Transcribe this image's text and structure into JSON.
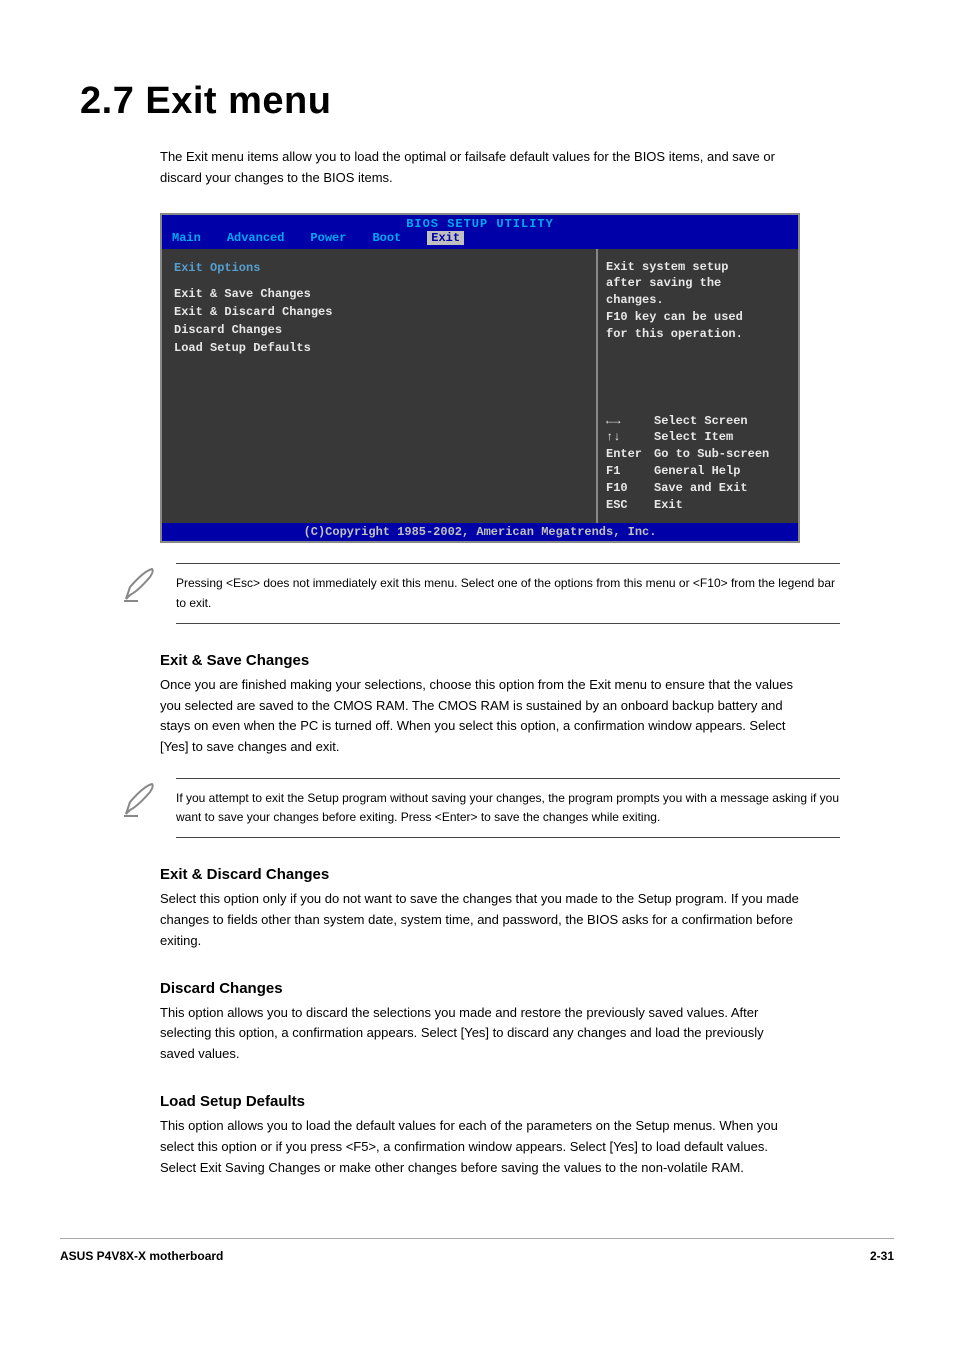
{
  "heading": "2.7    Exit menu",
  "intro": "The Exit menu items allow you to load the optimal or failsafe default values for the BIOS items, and save or discard your changes to the BIOS items.",
  "bios": {
    "title": "BIOS SETUP UTILITY",
    "tabs": [
      "Main",
      "Advanced",
      "Power",
      "Boot",
      "Exit"
    ],
    "active_tab": "Exit",
    "left_heading": "Exit Options",
    "items": [
      "Exit & Save Changes",
      "Exit & Discard Changes",
      "Discard Changes",
      "",
      "Load Setup Defaults"
    ],
    "right_help": [
      "Exit system setup",
      "after saving the",
      "changes.",
      "",
      "F10 key can be used",
      "for this operation."
    ],
    "legend": [
      {
        "key": "←→",
        "label": "Select Screen"
      },
      {
        "key": "↑↓",
        "label": "Select Item"
      },
      {
        "key": "Enter",
        "label": "Go to Sub-screen"
      },
      {
        "key": "F1",
        "label": "General Help"
      },
      {
        "key": "F10",
        "label": "Save and Exit"
      },
      {
        "key": "ESC",
        "label": "Exit"
      }
    ],
    "footer": "(C)Copyright 1985-2002, American Megatrends, Inc."
  },
  "note1": "Pressing <Esc> does not immediately exit this menu. Select one of the options from this menu or <F10> from the legend bar to exit.",
  "sections": [
    {
      "title": "Exit & Save Changes",
      "paras": [
        "Once you are finished making your selections, choose this option from the Exit menu to ensure that the values you selected are saved to the CMOS RAM. The CMOS RAM is sustained by an onboard backup battery and stays on even when the PC is turned off. When you select this option, a confirmation window appears. Select [Yes] to save changes and exit."
      ]
    }
  ],
  "note2": "If you attempt to exit the Setup program without saving your changes, the program prompts you with a message asking if you want to save your changes before exiting. Press <Enter> to save the changes while exiting.",
  "sections2": [
    {
      "title": "Exit & Discard Changes",
      "paras": [
        "Select this option only if you do not want to save the changes that you made to the Setup program. If you made changes to fields other than system date, system time, and password, the BIOS asks for a confirmation before exiting."
      ]
    },
    {
      "title": "Discard Changes",
      "paras": [
        "This option allows you to discard the selections you made and restore the previously saved values. After selecting this option, a confirmation appears. Select [Yes] to discard any changes and load the previously saved values."
      ]
    },
    {
      "title": "Load Setup Defaults",
      "paras": [
        "This option allows you to load the default values for each of the parameters on the Setup menus. When you select this option or if you press <F5>, a confirmation window appears. Select [Yes] to load default values. Select Exit Saving Changes or make other changes before saving the values to the non-volatile RAM."
      ]
    }
  ],
  "footer_left": "ASUS P4V8X-X motherboard",
  "footer_right": "2-31"
}
